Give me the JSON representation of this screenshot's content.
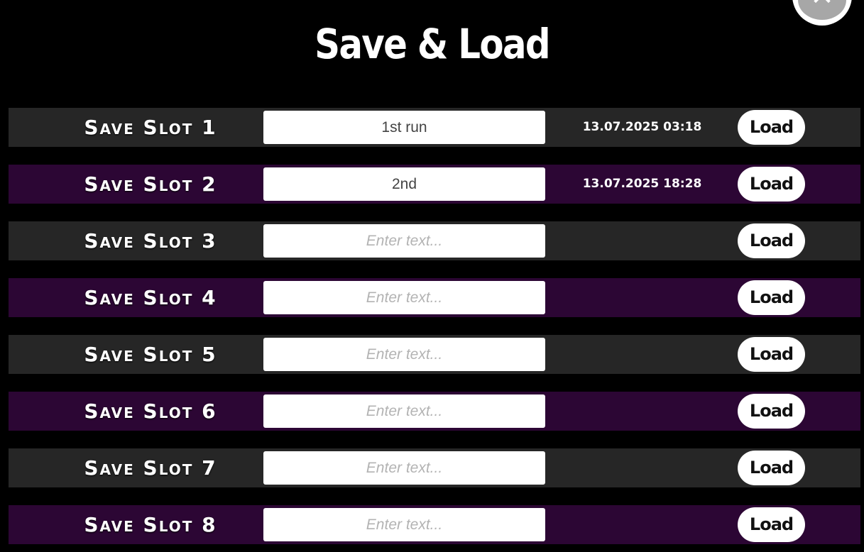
{
  "title": "Save & Load",
  "close_button": {
    "icon": "close-icon",
    "glyph": "✕"
  },
  "slots": [
    {
      "label": "Save Slot 1",
      "name_value": "1st run",
      "placeholder": "Enter text...",
      "date": "13.07.2025 03:18",
      "load_label": "Load",
      "theme": "dark"
    },
    {
      "label": "Save Slot 2",
      "name_value": "2nd",
      "placeholder": "Enter text...",
      "date": "13.07.2025 18:28",
      "load_label": "Load",
      "theme": "purple"
    },
    {
      "label": "Save Slot 3",
      "name_value": "",
      "placeholder": "Enter text...",
      "date": "",
      "load_label": "Load",
      "theme": "dark"
    },
    {
      "label": "Save Slot 4",
      "name_value": "",
      "placeholder": "Enter text...",
      "date": "",
      "load_label": "Load",
      "theme": "purple"
    },
    {
      "label": "Save Slot 5",
      "name_value": "",
      "placeholder": "Enter text...",
      "date": "",
      "load_label": "Load",
      "theme": "dark"
    },
    {
      "label": "Save Slot 6",
      "name_value": "",
      "placeholder": "Enter text...",
      "date": "",
      "load_label": "Load",
      "theme": "purple"
    },
    {
      "label": "Save Slot 7",
      "name_value": "",
      "placeholder": "Enter text...",
      "date": "",
      "load_label": "Load",
      "theme": "dark"
    },
    {
      "label": "Save Slot 8",
      "name_value": "",
      "placeholder": "Enter text...",
      "date": "",
      "load_label": "Load",
      "theme": "purple"
    }
  ],
  "colors": {
    "background": "#000000",
    "row_dark": "#262626",
    "row_purple": "#2c0634",
    "button_bg": "#ffffff",
    "close_inner": "#a7a7a7"
  }
}
